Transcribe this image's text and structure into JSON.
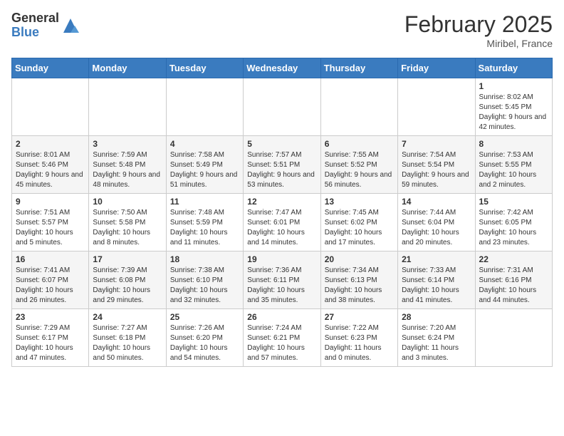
{
  "logo": {
    "general": "General",
    "blue": "Blue"
  },
  "header": {
    "month": "February 2025",
    "location": "Miribel, France"
  },
  "weekdays": [
    "Sunday",
    "Monday",
    "Tuesday",
    "Wednesday",
    "Thursday",
    "Friday",
    "Saturday"
  ],
  "weeks": [
    [
      {
        "day": "",
        "info": ""
      },
      {
        "day": "",
        "info": ""
      },
      {
        "day": "",
        "info": ""
      },
      {
        "day": "",
        "info": ""
      },
      {
        "day": "",
        "info": ""
      },
      {
        "day": "",
        "info": ""
      },
      {
        "day": "1",
        "info": "Sunrise: 8:02 AM\nSunset: 5:45 PM\nDaylight: 9 hours and 42 minutes."
      }
    ],
    [
      {
        "day": "2",
        "info": "Sunrise: 8:01 AM\nSunset: 5:46 PM\nDaylight: 9 hours and 45 minutes."
      },
      {
        "day": "3",
        "info": "Sunrise: 7:59 AM\nSunset: 5:48 PM\nDaylight: 9 hours and 48 minutes."
      },
      {
        "day": "4",
        "info": "Sunrise: 7:58 AM\nSunset: 5:49 PM\nDaylight: 9 hours and 51 minutes."
      },
      {
        "day": "5",
        "info": "Sunrise: 7:57 AM\nSunset: 5:51 PM\nDaylight: 9 hours and 53 minutes."
      },
      {
        "day": "6",
        "info": "Sunrise: 7:55 AM\nSunset: 5:52 PM\nDaylight: 9 hours and 56 minutes."
      },
      {
        "day": "7",
        "info": "Sunrise: 7:54 AM\nSunset: 5:54 PM\nDaylight: 9 hours and 59 minutes."
      },
      {
        "day": "8",
        "info": "Sunrise: 7:53 AM\nSunset: 5:55 PM\nDaylight: 10 hours and 2 minutes."
      }
    ],
    [
      {
        "day": "9",
        "info": "Sunrise: 7:51 AM\nSunset: 5:57 PM\nDaylight: 10 hours and 5 minutes."
      },
      {
        "day": "10",
        "info": "Sunrise: 7:50 AM\nSunset: 5:58 PM\nDaylight: 10 hours and 8 minutes."
      },
      {
        "day": "11",
        "info": "Sunrise: 7:48 AM\nSunset: 5:59 PM\nDaylight: 10 hours and 11 minutes."
      },
      {
        "day": "12",
        "info": "Sunrise: 7:47 AM\nSunset: 6:01 PM\nDaylight: 10 hours and 14 minutes."
      },
      {
        "day": "13",
        "info": "Sunrise: 7:45 AM\nSunset: 6:02 PM\nDaylight: 10 hours and 17 minutes."
      },
      {
        "day": "14",
        "info": "Sunrise: 7:44 AM\nSunset: 6:04 PM\nDaylight: 10 hours and 20 minutes."
      },
      {
        "day": "15",
        "info": "Sunrise: 7:42 AM\nSunset: 6:05 PM\nDaylight: 10 hours and 23 minutes."
      }
    ],
    [
      {
        "day": "16",
        "info": "Sunrise: 7:41 AM\nSunset: 6:07 PM\nDaylight: 10 hours and 26 minutes."
      },
      {
        "day": "17",
        "info": "Sunrise: 7:39 AM\nSunset: 6:08 PM\nDaylight: 10 hours and 29 minutes."
      },
      {
        "day": "18",
        "info": "Sunrise: 7:38 AM\nSunset: 6:10 PM\nDaylight: 10 hours and 32 minutes."
      },
      {
        "day": "19",
        "info": "Sunrise: 7:36 AM\nSunset: 6:11 PM\nDaylight: 10 hours and 35 minutes."
      },
      {
        "day": "20",
        "info": "Sunrise: 7:34 AM\nSunset: 6:13 PM\nDaylight: 10 hours and 38 minutes."
      },
      {
        "day": "21",
        "info": "Sunrise: 7:33 AM\nSunset: 6:14 PM\nDaylight: 10 hours and 41 minutes."
      },
      {
        "day": "22",
        "info": "Sunrise: 7:31 AM\nSunset: 6:16 PM\nDaylight: 10 hours and 44 minutes."
      }
    ],
    [
      {
        "day": "23",
        "info": "Sunrise: 7:29 AM\nSunset: 6:17 PM\nDaylight: 10 hours and 47 minutes."
      },
      {
        "day": "24",
        "info": "Sunrise: 7:27 AM\nSunset: 6:18 PM\nDaylight: 10 hours and 50 minutes."
      },
      {
        "day": "25",
        "info": "Sunrise: 7:26 AM\nSunset: 6:20 PM\nDaylight: 10 hours and 54 minutes."
      },
      {
        "day": "26",
        "info": "Sunrise: 7:24 AM\nSunset: 6:21 PM\nDaylight: 10 hours and 57 minutes."
      },
      {
        "day": "27",
        "info": "Sunrise: 7:22 AM\nSunset: 6:23 PM\nDaylight: 11 hours and 0 minutes."
      },
      {
        "day": "28",
        "info": "Sunrise: 7:20 AM\nSunset: 6:24 PM\nDaylight: 11 hours and 3 minutes."
      },
      {
        "day": "",
        "info": ""
      }
    ]
  ]
}
